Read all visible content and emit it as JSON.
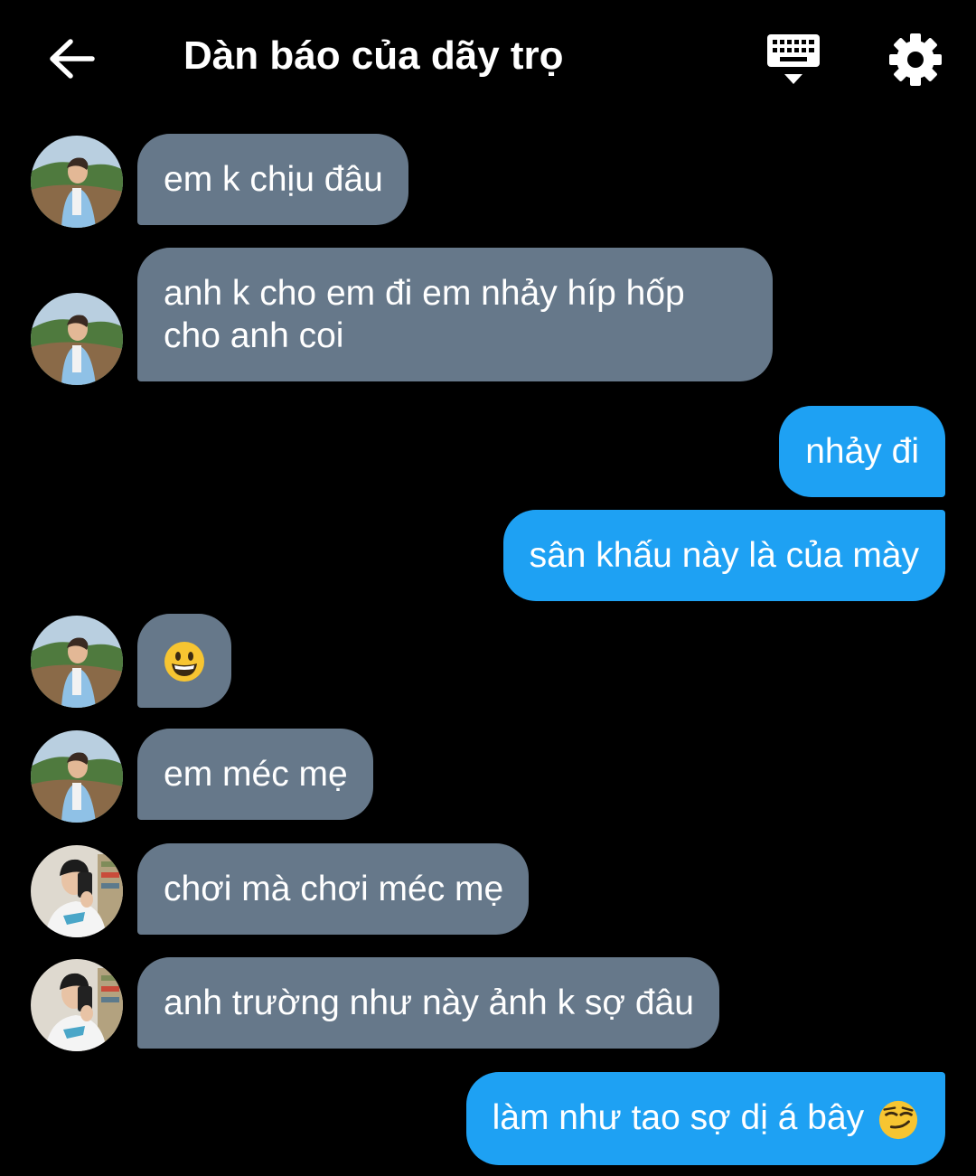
{
  "header": {
    "title": "Dàn báo của dãy trọ",
    "icons": {
      "back": "arrow-left-icon",
      "keyboard": "keyboard-icon",
      "settings": "gear-icon"
    }
  },
  "colors": {
    "background": "#000000",
    "incoming_bubble": "#66788a",
    "outgoing_bubble": "#1ea1f3",
    "text": "#ffffff"
  },
  "messages": [
    {
      "side": "in",
      "sender": "user1",
      "text": "em k chịu đâu"
    },
    {
      "side": "in",
      "sender": "user1",
      "text": "anh k cho em đi em nhảy híp hốp cho anh coi"
    },
    {
      "side": "out",
      "text": "nhảy đi"
    },
    {
      "side": "out",
      "text": "sân khấu này là của mày"
    },
    {
      "side": "in",
      "sender": "user1",
      "emoji": "grinning-face"
    },
    {
      "side": "in",
      "sender": "user1",
      "text": "em méc mẹ"
    },
    {
      "side": "in",
      "sender": "user2",
      "text": "chơi mà chơi méc mẹ"
    },
    {
      "side": "in",
      "sender": "user2",
      "text": "anh trường như này ảnh k sợ đâu"
    },
    {
      "side": "out",
      "text": "làm như tao sợ dị á bây",
      "emoji": "smirking-face"
    }
  ]
}
